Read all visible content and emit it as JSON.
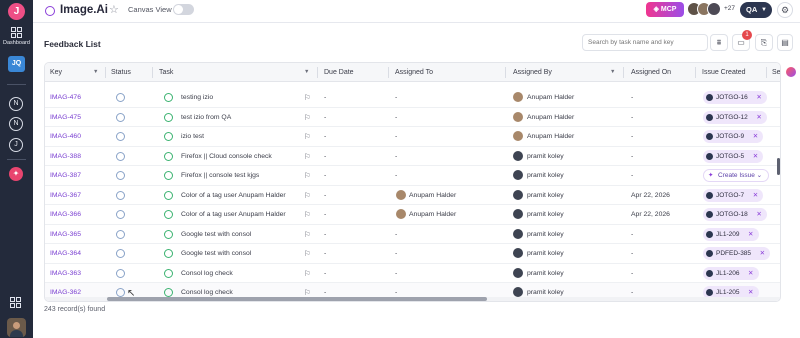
{
  "app": {
    "logo_letter": "J",
    "title": "Image.Ai",
    "canvas_label": "Canvas View",
    "mcp_label": "MCP",
    "more_users": "+27",
    "user_initials": "QA"
  },
  "sidebar": {
    "dashboard_label": "Dashboard",
    "workspace_badge": "JQ",
    "items": [
      "N",
      "N",
      "J"
    ]
  },
  "page": {
    "title": "Feedback List",
    "search_placeholder": "Search by task name and key",
    "notification_count": "1",
    "records_text": "243 record(s) found"
  },
  "table": {
    "columns": [
      "Key",
      "Status",
      "Task",
      "Due Date",
      "Assigned To",
      "Assigned By",
      "Assigned On",
      "Issue Created",
      "Se"
    ],
    "rows": [
      {
        "key": "IMAG-476",
        "task": "testing izio",
        "due": "-",
        "assigned_to": "-",
        "assigned_by": "Anupam Halder",
        "assigned_on": "-",
        "issue": "JOTGO-16"
      },
      {
        "key": "IMAG-475",
        "task": "test izio from QA",
        "due": "-",
        "assigned_to": "-",
        "assigned_by": "Anupam Halder",
        "assigned_on": "-",
        "issue": "JOTGO-12"
      },
      {
        "key": "IMAG-460",
        "task": "izio test",
        "due": "-",
        "assigned_to": "-",
        "assigned_by": "Anupam Halder",
        "assigned_on": "-",
        "issue": "JOTGO-9"
      },
      {
        "key": "IMAG-388",
        "task": "Firefox || Cloud console check",
        "due": "-",
        "assigned_to": "-",
        "assigned_by": "pramit koley",
        "assigned_on": "-",
        "issue": "JOTGO-5"
      },
      {
        "key": "IMAG-387",
        "task": "Firefox || console test kjgs",
        "due": "-",
        "assigned_to": "-",
        "assigned_by": "pramit koley",
        "assigned_on": "-",
        "issue": "Create Issue"
      },
      {
        "key": "IMAG-367",
        "task": "Color of a tag user Anupam Halder",
        "due": "-",
        "assigned_to": "Anupam Halder",
        "assigned_by": "pramit koley",
        "assigned_on": "Apr 22, 2026",
        "issue": "JOTGO-7"
      },
      {
        "key": "IMAG-366",
        "task": "Color of a tag user Anupam Halder",
        "due": "-",
        "assigned_to": "Anupam Halder",
        "assigned_by": "pramit koley",
        "assigned_on": "Apr 22, 2026",
        "issue": "JOTGO-18"
      },
      {
        "key": "IMAG-365",
        "task": "Google test with consol",
        "due": "-",
        "assigned_to": "-",
        "assigned_by": "pramit koley",
        "assigned_on": "-",
        "issue": "JL1-209"
      },
      {
        "key": "IMAG-364",
        "task": "Google test with consol",
        "due": "-",
        "assigned_to": "-",
        "assigned_by": "pramit koley",
        "assigned_on": "-",
        "issue": "PDFED-385"
      },
      {
        "key": "IMAG-363",
        "task": "Consol log check",
        "due": "-",
        "assigned_to": "-",
        "assigned_by": "pramit koley",
        "assigned_on": "-",
        "issue": "JL1-206"
      },
      {
        "key": "IMAG-362",
        "task": "Consol log check",
        "due": "-",
        "assigned_to": "-",
        "assigned_by": "pramit koley",
        "assigned_on": "-",
        "issue": "JL1-205"
      }
    ]
  }
}
